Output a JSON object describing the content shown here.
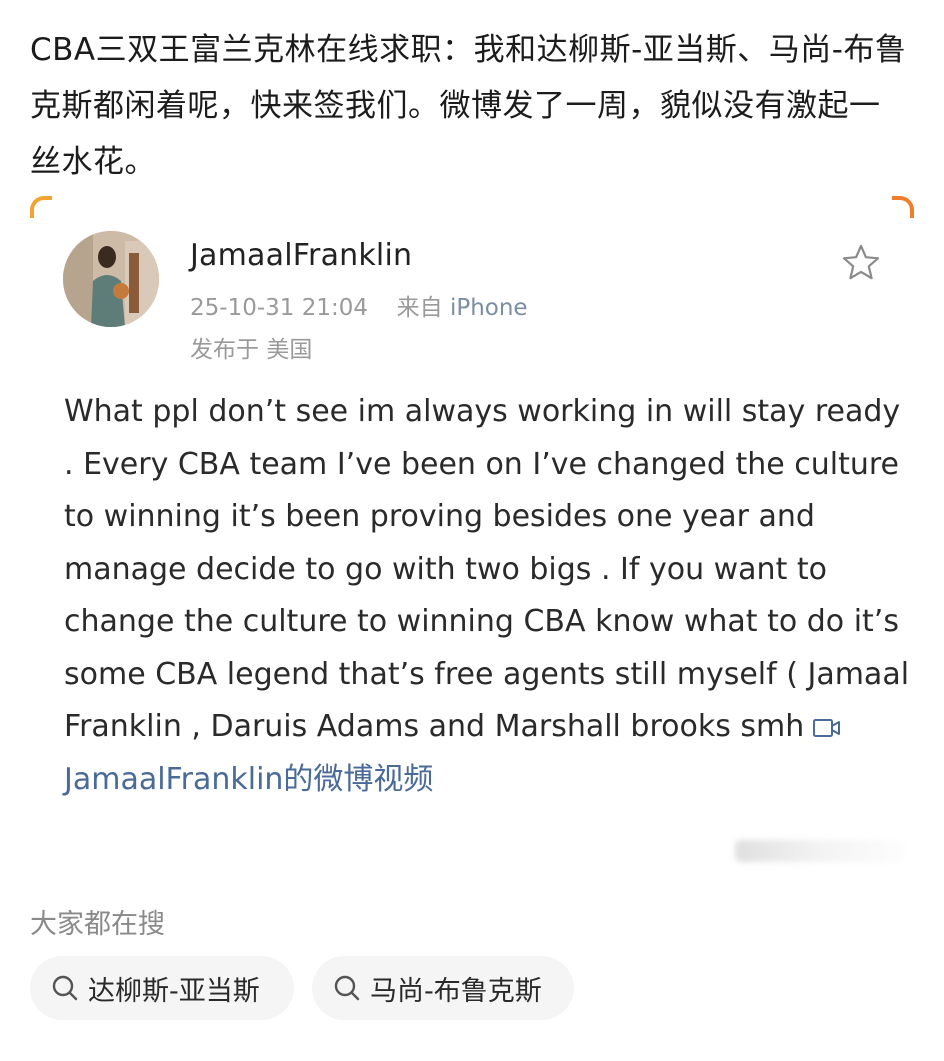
{
  "headline": "CBA三双王富兰克林在线求职：我和达柳斯-亚当斯、马尚-布鲁克斯都闲着呢，快来签我们。微博发了一周，貌似没有激起一丝水花。",
  "post": {
    "username": "JamaalFranklin",
    "timestamp": "25-10-31 21:04",
    "source_prefix": "来自",
    "device": "iPhone",
    "location_prefix": "发布于",
    "location": "美国",
    "text": "What ppl don’t see im always working in will stay ready . Every CBA team I’ve been on I’ve changed the culture to winning it’s been proving besides one year and manage decide to go with two bigs . If you want to change the culture to winning CBA know what to do it’s some CBA legend that’s free agents still myself ( Jamaal Franklin , Daruis Adams and Marshall brooks smh",
    "video_link": "JamaalFranklin的微博视频",
    "icons": {
      "favorite": "star-outline-icon",
      "video": "video-camera-icon"
    }
  },
  "search": {
    "title": "大家都在搜",
    "chips": [
      {
        "label": "达柳斯-亚当斯",
        "icon": "search-icon"
      },
      {
        "label": "马尚-布鲁克斯",
        "icon": "search-icon"
      }
    ]
  },
  "colors": {
    "link": "#4a6a98",
    "meta": "#9a9a9a",
    "card_accent_left": "#f2a330",
    "card_accent_right": "#f07d2d",
    "chip_bg": "#f5f5f5"
  }
}
